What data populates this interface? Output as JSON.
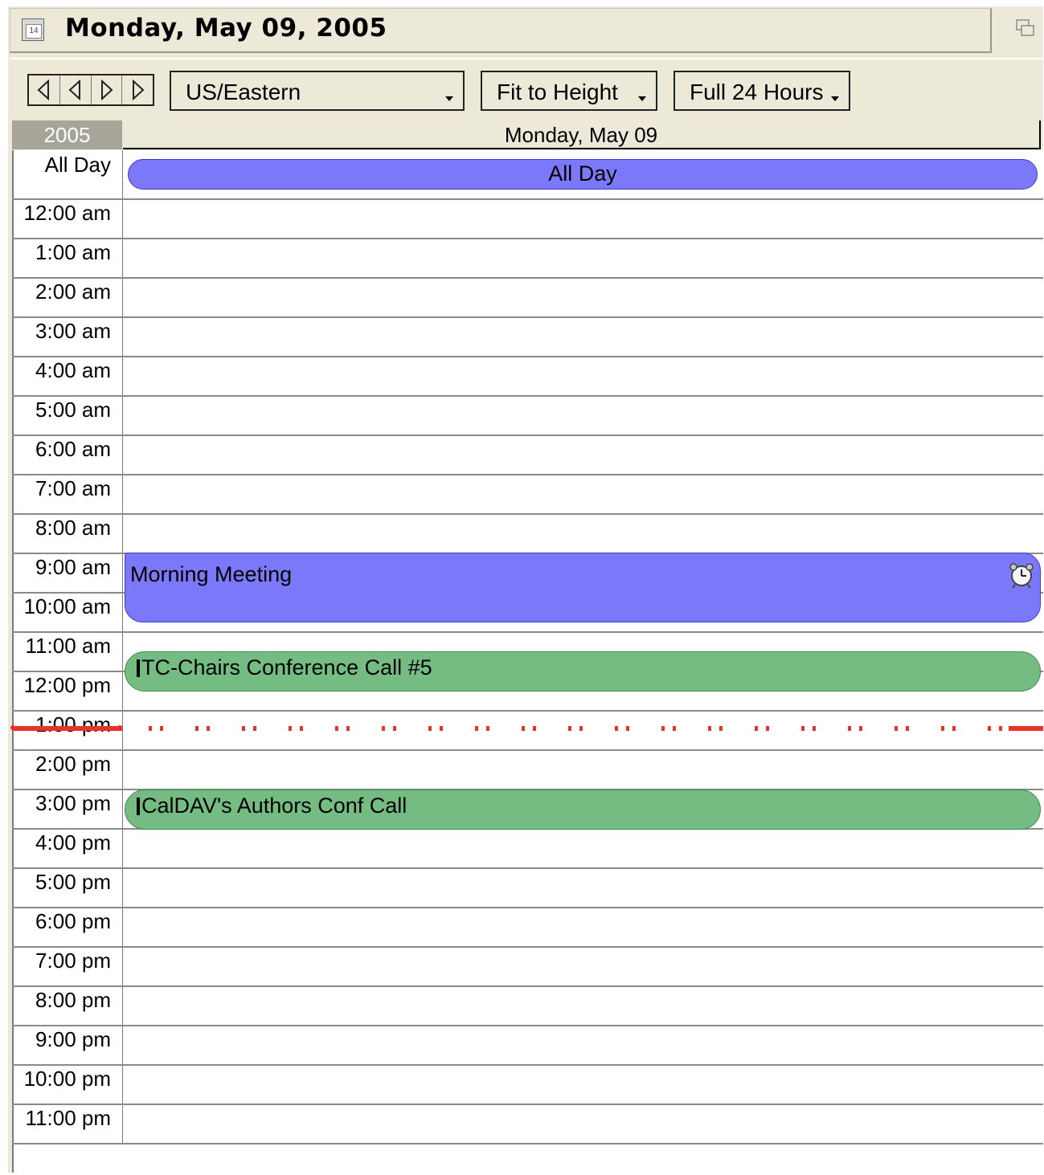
{
  "title": {
    "text": "Monday, May 09, 2005",
    "calendar_icon_text": "14"
  },
  "toolbar": {
    "nav_buttons": [
      "previous-first",
      "previous",
      "next",
      "next-last"
    ],
    "timezone": "US/Eastern",
    "fit_mode": "Fit to Height",
    "hours_mode": "Full 24 Hours"
  },
  "grid": {
    "year": "2005",
    "day_header": "Monday, May 09",
    "allday_label": "All Day",
    "hours": [
      "12:00 am",
      "1:00 am",
      "2:00 am",
      "3:00 am",
      "4:00 am",
      "5:00 am",
      "6:00 am",
      "7:00 am",
      "8:00 am",
      "9:00 am",
      "10:00 am",
      "11:00 am",
      "12:00 pm",
      "1:00 pm",
      "2:00 pm",
      "3:00 pm",
      "4:00 pm",
      "5:00 pm",
      "6:00 pm",
      "7:00 pm",
      "8:00 pm",
      "9:00 pm",
      "10:00 pm",
      "11:00 pm"
    ]
  },
  "events": {
    "allday": "All Day",
    "morning": "Morning Meeting",
    "tc_chairs": "TC-Chairs Conference Call #5",
    "caldav": "CalDAV's Authors Conf Call"
  },
  "colors": {
    "event_blue": "#7b79fa",
    "event_green": "#74bc82",
    "now_line": "#e8332a",
    "chrome": "#ece9d8"
  }
}
